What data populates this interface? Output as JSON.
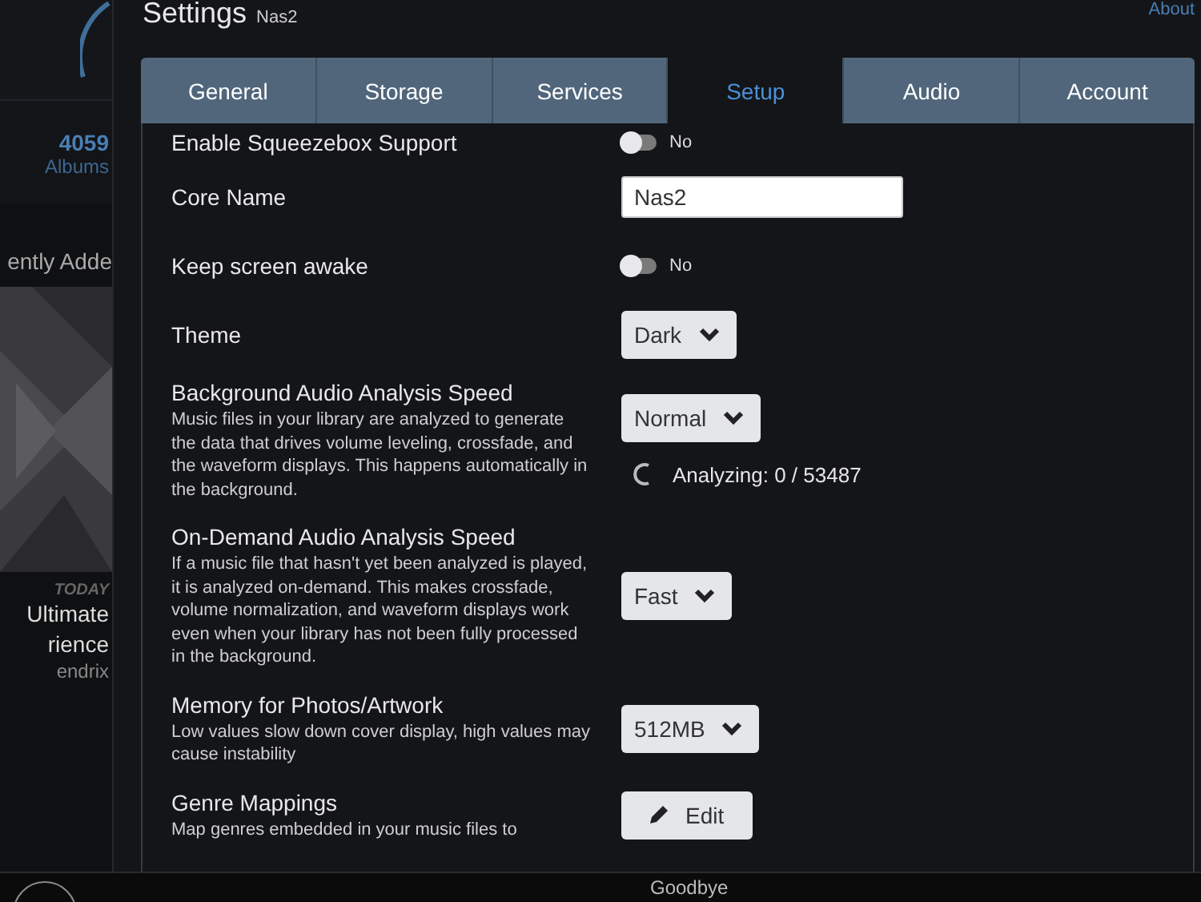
{
  "background_app": {
    "stat_count": "4059",
    "stat_label": "Albums",
    "section_title": "ently Adde",
    "album": {
      "kind": "picture",
      "tag": "TODAY",
      "title_lines": [
        "Ultimate",
        "rience"
      ],
      "artist": "endrix"
    }
  },
  "header": {
    "title": "Settings",
    "subtitle": "Nas2",
    "link": "About"
  },
  "tabs": [
    {
      "label": "General",
      "selected": false
    },
    {
      "label": "Storage",
      "selected": false
    },
    {
      "label": "Services",
      "selected": false
    },
    {
      "label": "Setup",
      "selected": true
    },
    {
      "label": "Audio",
      "selected": false
    },
    {
      "label": "Account",
      "selected": false
    }
  ],
  "settings": [
    {
      "kind": "toggle",
      "label": "Enable Squeezebox Support",
      "on": false,
      "value_text": "No"
    },
    {
      "kind": "text",
      "label": "Core Name",
      "value": "Nas2"
    },
    {
      "kind": "toggle",
      "label": "Keep screen awake",
      "on": false,
      "value_text": "No"
    },
    {
      "kind": "dropdown",
      "label": "Theme",
      "value": "Dark"
    },
    {
      "kind": "dropdown",
      "label": "Background Audio Analysis Speed",
      "description": "Music files in your library are analyzed to generate the data that drives volume leveling, crossfade, and the waveform displays. This happens automatically in the background.",
      "value": "Normal",
      "status": "Analyzing: 0 / 53487"
    },
    {
      "kind": "dropdown",
      "label": "On-Demand Audio Analysis Speed",
      "description": "If a music file that hasn't yet been analyzed is played, it is analyzed on-demand. This makes crossfade, volume normalization, and waveform displays work even when your library has not been fully processed in the background.",
      "value": "Fast"
    },
    {
      "kind": "dropdown",
      "label": "Memory for Photos/Artwork",
      "description": "Low values slow down cover display, high values may cause instability",
      "value": "512MB"
    },
    {
      "kind": "button",
      "label": "Genre Mappings",
      "description": "Map genres embedded in your music files to",
      "button": "Edit"
    }
  ],
  "footer": {
    "text": "Goodbye"
  }
}
